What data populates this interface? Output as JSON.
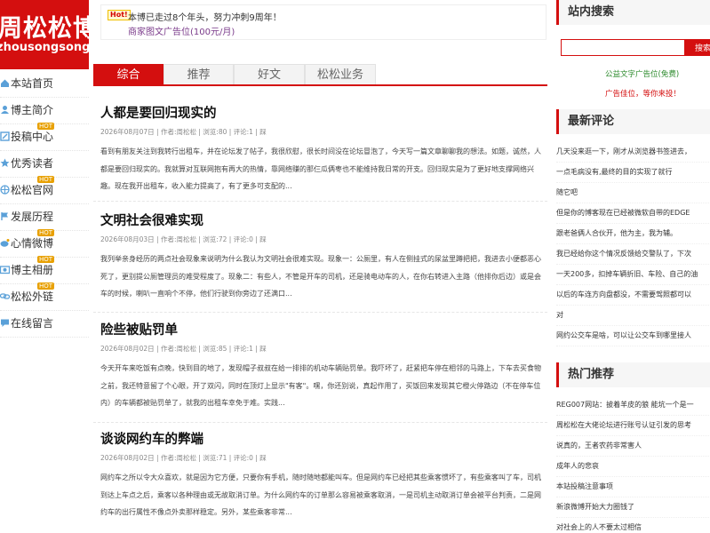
{
  "logo": {
    "title": "周松松博客",
    "domain": "zhousongsong.com"
  },
  "nav": [
    {
      "label": "本站首页",
      "icon": "home-icon",
      "hot": ""
    },
    {
      "label": "博主简介",
      "icon": "user-icon",
      "hot": ""
    },
    {
      "label": "投稿中心",
      "icon": "edit-icon",
      "hot": "HOT"
    },
    {
      "label": "优秀读者",
      "icon": "star-icon",
      "hot": ""
    },
    {
      "label": "松松官网",
      "icon": "globe-icon",
      "hot": "HOT"
    },
    {
      "label": "发展历程",
      "icon": "flag-icon",
      "hot": ""
    },
    {
      "label": "心情微博",
      "icon": "weibo-icon",
      "hot": "HOT"
    },
    {
      "label": "博主相册",
      "icon": "photo-icon",
      "hot": "HOT"
    },
    {
      "label": "松松外链",
      "icon": "link-icon",
      "hot": "HOT"
    },
    {
      "label": "在线留言",
      "icon": "comment-icon",
      "hot": ""
    }
  ],
  "notice": {
    "badge": "Hot!",
    "message": "本博已走过8个年头，努力冲刺9周年！",
    "ad": "商家图文广告位(100元/月)"
  },
  "tabs": [
    "综合",
    "推荐",
    "好文",
    "松松业务"
  ],
  "articles": [
    {
      "title": "人都是要回归现实的",
      "meta": "2026年08月07日 | 作者:周松松 | 浏览:80 | 评论:1 | 踩",
      "excerpt": "看到有朋友关注到我转行出租车，并在论坛发了帖子，我很欣慰，很长时间没在论坛冒泡了，今天写一篇文章聊聊我的想法。如题，诚然，人都是要回归现实的。我就算对互联网抱有再大的热情，靠网络赚的那仨瓜俩枣也不能维持我日常的开支。回归现实是为了更好地支撑网络兴趣。现在我开出租车，收入能力提高了，有了更多可支配的..."
    },
    {
      "title": "文明社会很难实现",
      "meta": "2026年08月03日 | 作者:周松松 | 浏览:72 | 评论:0 | 踩",
      "excerpt": "我列举亲身经历的两点社会现象来说明为什么我认为文明社会很难实现。现象一：公厕里，有人在侧挂式的尿盆里蹲把把，我进去小便都恶心死了，更别提公厕管理员的难受程度了。现象二：有些人，不管是开车的司机，还是骑电动车的人，在你右转进入主路（他排你后边）或是会车的时候，喇叭一直响个不停，他们行驶到你旁边了还满口..."
    },
    {
      "title": "险些被贴罚单",
      "meta": "2026年08月02日 | 作者:周松松 | 浏览:85 | 评论:1 | 踩",
      "excerpt": "今天开车来吃饭有点晚，快到目的地了，发现帽子叔叔在给一排排的机动车辆贴罚单。我吓坏了，赶紧把车停在相邻的马路上，下车去买食物之前，我还特意留了个心眼，开了双闪，同时在顶灯上显示\"有客\"。嘿，你还别说，真起作用了，买饭回来发现其它橙火停路边（不在停车位内）的车辆都被贴罚单了，就我的出租车幸免于难。实践..."
    },
    {
      "title": "谈谈网约车的弊端",
      "meta": "2026年08月02日 | 作者:周松松 | 浏览:71 | 评论:0 | 踩",
      "excerpt": "网约车之所以令大众喜欢，就是因为它方便，只要你有手机，随时随地都能叫车。但是网约车已经把其些乘客惯坏了，有些乘客叫了车，司机到达上车点之后，乘客以各种理由或无故取消订单。为什么网约车的订单那么容易被乘客取消，一是司机主动取消订单会被平台判责，二是网约车的出行属性不像点外卖那样稳定。另外，某些乘客非常..."
    }
  ],
  "sidebar": {
    "search_title": "站内搜索",
    "search_placeholder": "",
    "search_button": "搜索",
    "ad_free": "公益文字广告位(免费)",
    "ad_paid": "广告佳位，等你来投！",
    "comments_title": "最新评论",
    "comments": [
      "几天没来逛一下，刚才从浏览器书签进去，",
      "一点毛病没有,最终的目的实现了就行",
      "随它吧",
      "但是你的博客现在已经被微软自带的EDGE",
      "跟老爸俩人合伙开，他为主，我为辅。",
      "我已经给你这个情况反馈给交警队了，下次",
      "一天200多，扣掉车辆折旧、车险、自己的油",
      "以后的车连方向盘都没，不需要驾照都可以",
      "对",
      "网约公交车是啥，可以让公交车到哪里接人"
    ],
    "hot_title": "热门推荐",
    "hot": [
      "REG007网站：披着羊皮的狼 能坑一个是一",
      "周松松在大佬论坛进行账号认证引发的思考",
      "说真的，王者农药非常害人",
      "成年人的悲哀",
      "本站投稿注意事项",
      "新浪微博开始大力圈钱了",
      "对社会上的人不要太过相信"
    ]
  },
  "colors": {
    "accent": "#d40f0f",
    "notice_ad": "#7a3a8a",
    "ad_free": "#2e8b2e",
    "ad_paid": "#d40f0f"
  }
}
